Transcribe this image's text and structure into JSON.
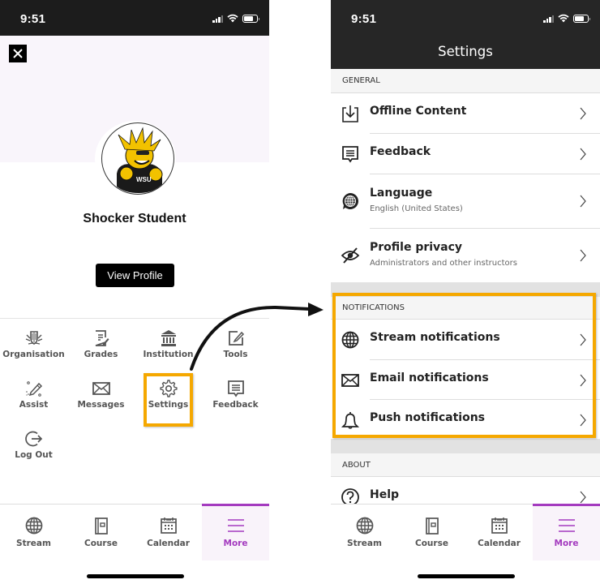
{
  "left_screen": {
    "status_bar": {
      "time": "9:51"
    },
    "close_label": "✕",
    "profile": {
      "name": "Shocker Student",
      "view_profile_label": "View Profile"
    },
    "menu_items": [
      {
        "label": "Organisation",
        "icon": "organisation-icon"
      },
      {
        "label": "Grades",
        "icon": "grades-icon"
      },
      {
        "label": "Institution",
        "icon": "institution-icon"
      },
      {
        "label": "Tools",
        "icon": "tools-icon"
      },
      {
        "label": "Assist",
        "icon": "assist-icon"
      },
      {
        "label": "Messages",
        "icon": "messages-icon"
      },
      {
        "label": "Settings",
        "icon": "gear-icon",
        "highlighted": true
      },
      {
        "label": "Feedback",
        "icon": "feedback-icon"
      },
      {
        "label": "Log Out",
        "icon": "logout-icon"
      }
    ],
    "tabs": [
      {
        "label": "Stream",
        "icon": "globe-icon"
      },
      {
        "label": "Course",
        "icon": "course-icon"
      },
      {
        "label": "Calendar",
        "icon": "calendar-icon"
      },
      {
        "label": "More",
        "icon": "menu-icon",
        "active": true
      }
    ]
  },
  "right_screen": {
    "status_bar": {
      "time": "9:51"
    },
    "title": "Settings",
    "sections": {
      "general": {
        "header": "GENERAL",
        "items": [
          {
            "title": "Offline Content",
            "icon": "download-icon"
          },
          {
            "title": "Feedback",
            "icon": "feedback-icon"
          },
          {
            "title": "Language",
            "subtitle": "English (United States)",
            "icon": "language-icon"
          },
          {
            "title": "Profile privacy",
            "subtitle": "Administrators and other instructors",
            "icon": "eye-slash-icon"
          }
        ]
      },
      "notifications": {
        "header": "NOTIFICATIONS",
        "highlighted": true,
        "items": [
          {
            "title": "Stream notifications",
            "icon": "globe-icon"
          },
          {
            "title": "Email notifications",
            "icon": "envelope-icon"
          },
          {
            "title": "Push notifications",
            "icon": "bell-icon"
          }
        ]
      },
      "about": {
        "header": "ABOUT",
        "items": [
          {
            "title": "Help",
            "icon": "help-icon"
          }
        ]
      }
    },
    "tabs": [
      {
        "label": "Stream",
        "icon": "globe-icon"
      },
      {
        "label": "Course",
        "icon": "course-icon"
      },
      {
        "label": "Calendar",
        "icon": "calendar-icon"
      },
      {
        "label": "More",
        "icon": "menu-icon",
        "active": true
      }
    ]
  },
  "colors": {
    "highlight": "#f5a800",
    "accent_purple": "#a43bbf",
    "header_dark": "#262626",
    "profile_band": "#f9f5fb"
  }
}
